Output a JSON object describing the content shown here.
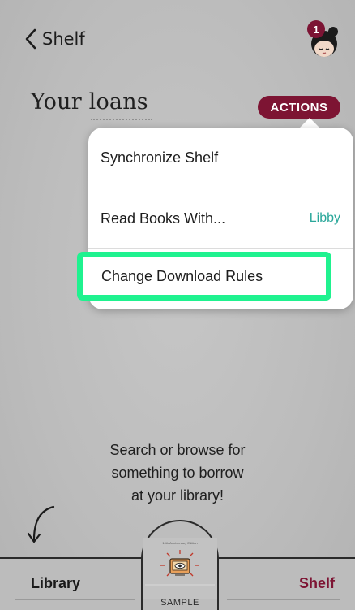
{
  "header": {
    "back_label": "Shelf",
    "notification_count": "1"
  },
  "page": {
    "title": "Your loans",
    "actions_label": "ACTIONS"
  },
  "menu": {
    "items": [
      {
        "label": "Synchronize Shelf",
        "value": ""
      },
      {
        "label": "Read Books With...",
        "value": "Libby"
      },
      {
        "label": "Change Download Rules",
        "value": ""
      }
    ]
  },
  "empty_message": {
    "line1": "Search or browse for",
    "line2": "something to borrow",
    "line3": "at your library!"
  },
  "tabbar": {
    "library_label": "Library",
    "shelf_label": "Shelf",
    "sample_label": "SAMPLE",
    "book_caption": "10th Anniversary Edition"
  },
  "colors": {
    "accent": "#7d1433",
    "link": "#2aa79a",
    "highlight": "#1ff28f",
    "background": "#bdbdbd"
  },
  "icons": {
    "back": "chevron-left-icon",
    "avatar": "reader-avatar-icon",
    "arrow": "curved-arrow-icon",
    "book": "eye-book-icon"
  }
}
